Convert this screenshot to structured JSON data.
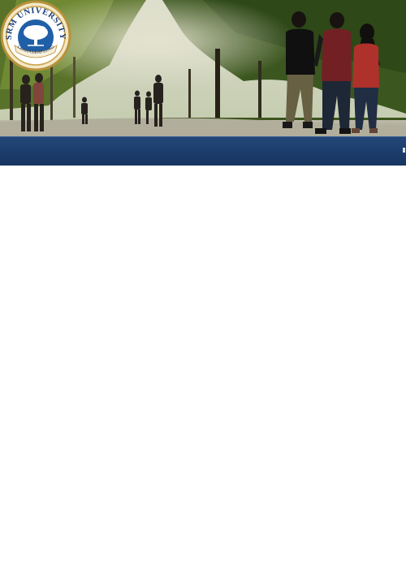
{
  "header": {
    "banner_image": "campus-walkway-photo",
    "logo": {
      "arc_text_top": "SRM UNIVERSITY",
      "ribbon_text": "LEARN.LEAP.LEAD",
      "emblem": "tree"
    }
  },
  "colors": {
    "navbar": "#1b3b69",
    "logo_ring": "#c9a24a",
    "logo_inner": "#1f5fa8",
    "background": "#ffffff"
  }
}
